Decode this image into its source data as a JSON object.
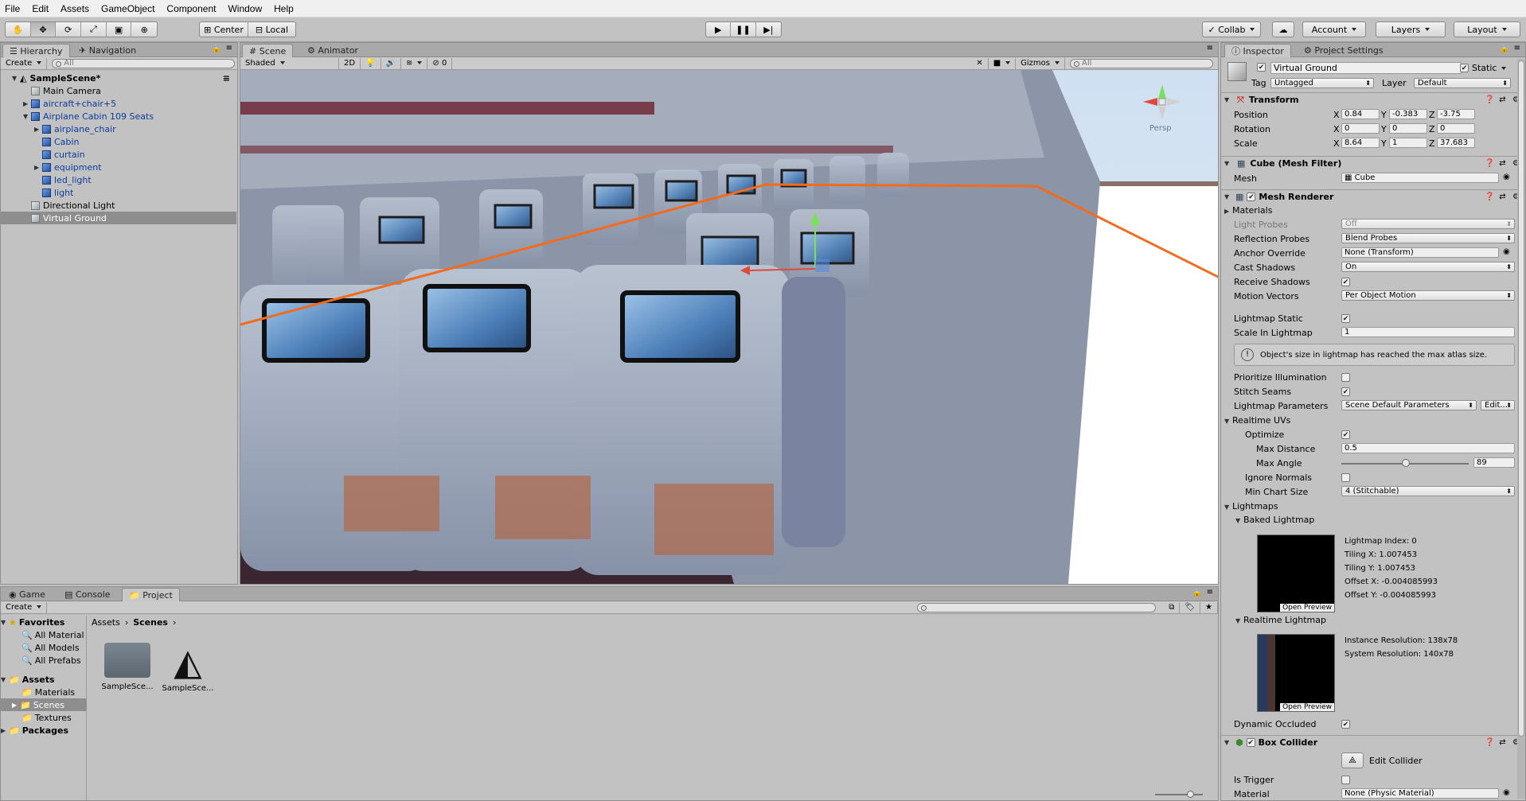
{
  "menu": [
    "File",
    "Edit",
    "Assets",
    "GameObject",
    "Component",
    "Window",
    "Help"
  ],
  "toolbar": {
    "pivot": "Center",
    "space": "Local",
    "collab": "Collab",
    "account": "Account",
    "layers": "Layers",
    "layout": "Layout"
  },
  "hierarchy": {
    "tab": "Hierarchy",
    "tab2": "Navigation",
    "create": "Create",
    "search_placeholder": "All",
    "scene": "SampleScene*",
    "items": [
      {
        "label": "Main Camera",
        "indent": 1,
        "expand": "",
        "blue": false
      },
      {
        "label": "aircraft+chair+5",
        "indent": 1,
        "expand": "▶",
        "blue": true
      },
      {
        "label": "Airplane Cabin 109 Seats",
        "indent": 1,
        "expand": "▼",
        "blue": true
      },
      {
        "label": "airplane_chair",
        "indent": 2,
        "expand": "▶",
        "blue": true
      },
      {
        "label": "Cabin",
        "indent": 2,
        "expand": "",
        "blue": true
      },
      {
        "label": "curtain",
        "indent": 2,
        "expand": "",
        "blue": true
      },
      {
        "label": "equipment",
        "indent": 2,
        "expand": "▶",
        "blue": true
      },
      {
        "label": "led_light",
        "indent": 2,
        "expand": "",
        "blue": true
      },
      {
        "label": "light",
        "indent": 2,
        "expand": "",
        "blue": true
      },
      {
        "label": "Directional Light",
        "indent": 1,
        "expand": "",
        "blue": false
      },
      {
        "label": "Virtual Ground",
        "indent": 1,
        "expand": "",
        "blue": false,
        "selected": true
      }
    ]
  },
  "scene": {
    "tab": "Scene",
    "tab2": "Animator",
    "shading": "Shaded",
    "mode2d": "2D",
    "fx_count": "0",
    "gizmos": "Gizmos",
    "search_placeholder": "All",
    "persp": "Persp"
  },
  "inspector": {
    "tab": "Inspector",
    "tab2": "Project Settings",
    "object_name": "Virtual Ground",
    "static_label": "Static",
    "tag_label": "Tag",
    "tag_value": "Untagged",
    "layer_label": "Layer",
    "layer_value": "Default",
    "transform": {
      "title": "Transform",
      "position_label": "Position",
      "rotation_label": "Rotation",
      "scale_label": "Scale",
      "position": [
        "0.84",
        "-0.383",
        "-3.75"
      ],
      "rotation": [
        "0",
        "0",
        "0"
      ],
      "scale": [
        "8.64",
        "1",
        "37.683"
      ]
    },
    "mesh_filter": {
      "title": "Cube (Mesh Filter)",
      "mesh_label": "Mesh",
      "mesh_value": "Cube"
    },
    "mesh_renderer": {
      "title": "Mesh Renderer",
      "materials": "Materials",
      "light_probes_label": "Light Probes",
      "light_probes_value": "Off",
      "reflection_probes_label": "Reflection Probes",
      "reflection_probes_value": "Blend Probes",
      "anchor_override_label": "Anchor Override",
      "anchor_override_value": "None (Transform)",
      "cast_shadows_label": "Cast Shadows",
      "cast_shadows_value": "On",
      "receive_shadows_label": "Receive Shadows",
      "motion_vectors_label": "Motion Vectors",
      "motion_vectors_value": "Per Object Motion",
      "lightmap_static_label": "Lightmap Static",
      "scale_in_lightmap_label": "Scale In Lightmap",
      "scale_in_lightmap_value": "1",
      "info": "Object's size in lightmap has reached the max atlas size.",
      "prioritize_label": "Prioritize Illumination",
      "stitch_label": "Stitch Seams",
      "lightmap_params_label": "Lightmap Parameters",
      "lightmap_params_value": "Scene Default Parameters",
      "edit_btn": "Edit...",
      "realtime_uvs": "Realtime UVs",
      "optimize_label": "Optimize",
      "max_distance_label": "Max Distance",
      "max_distance_value": "0.5",
      "max_angle_label": "Max Angle",
      "max_angle_value": "89",
      "ignore_normals_label": "Ignore Normals",
      "min_chart_label": "Min Chart Size",
      "min_chart_value": "4 (Stitchable)",
      "lightmaps": "Lightmaps",
      "baked_lightmap": "Baked Lightmap",
      "baked_info": [
        "Lightmap Index: 0",
        "Tiling X: 1.007453",
        "Tiling Y: 1.007453",
        "Offset X: -0.004085993",
        "Offset Y: -0.004085993"
      ],
      "open_preview": "Open Preview",
      "realtime_lightmap": "Realtime Lightmap",
      "realtime_info": [
        "Instance Resolution: 138x78",
        "System Resolution: 140x78"
      ],
      "dynamic_occluded_label": "Dynamic Occluded"
    },
    "box_collider": {
      "title": "Box Collider",
      "edit_collider": "Edit Collider",
      "is_trigger_label": "Is Trigger",
      "material_label": "Material",
      "material_value": "None (Physic Material)"
    }
  },
  "bottom": {
    "tabs": [
      "Game",
      "Console",
      "Project"
    ],
    "create": "Create",
    "favorites": "Favorites",
    "fav_items": [
      "All Material",
      "All Models",
      "All Prefabs"
    ],
    "assets": "Assets",
    "asset_items": [
      "Materials",
      "Scenes",
      "Textures"
    ],
    "packages": "Packages",
    "breadcrumb": [
      "Assets",
      "Scenes"
    ],
    "files": [
      "SampleSce...",
      "SampleSce..."
    ]
  },
  "colors": {
    "selection_outline": "#f26b1d",
    "panel_bg": "#c2c2c2",
    "tab_bg": "#a9a9a9"
  }
}
